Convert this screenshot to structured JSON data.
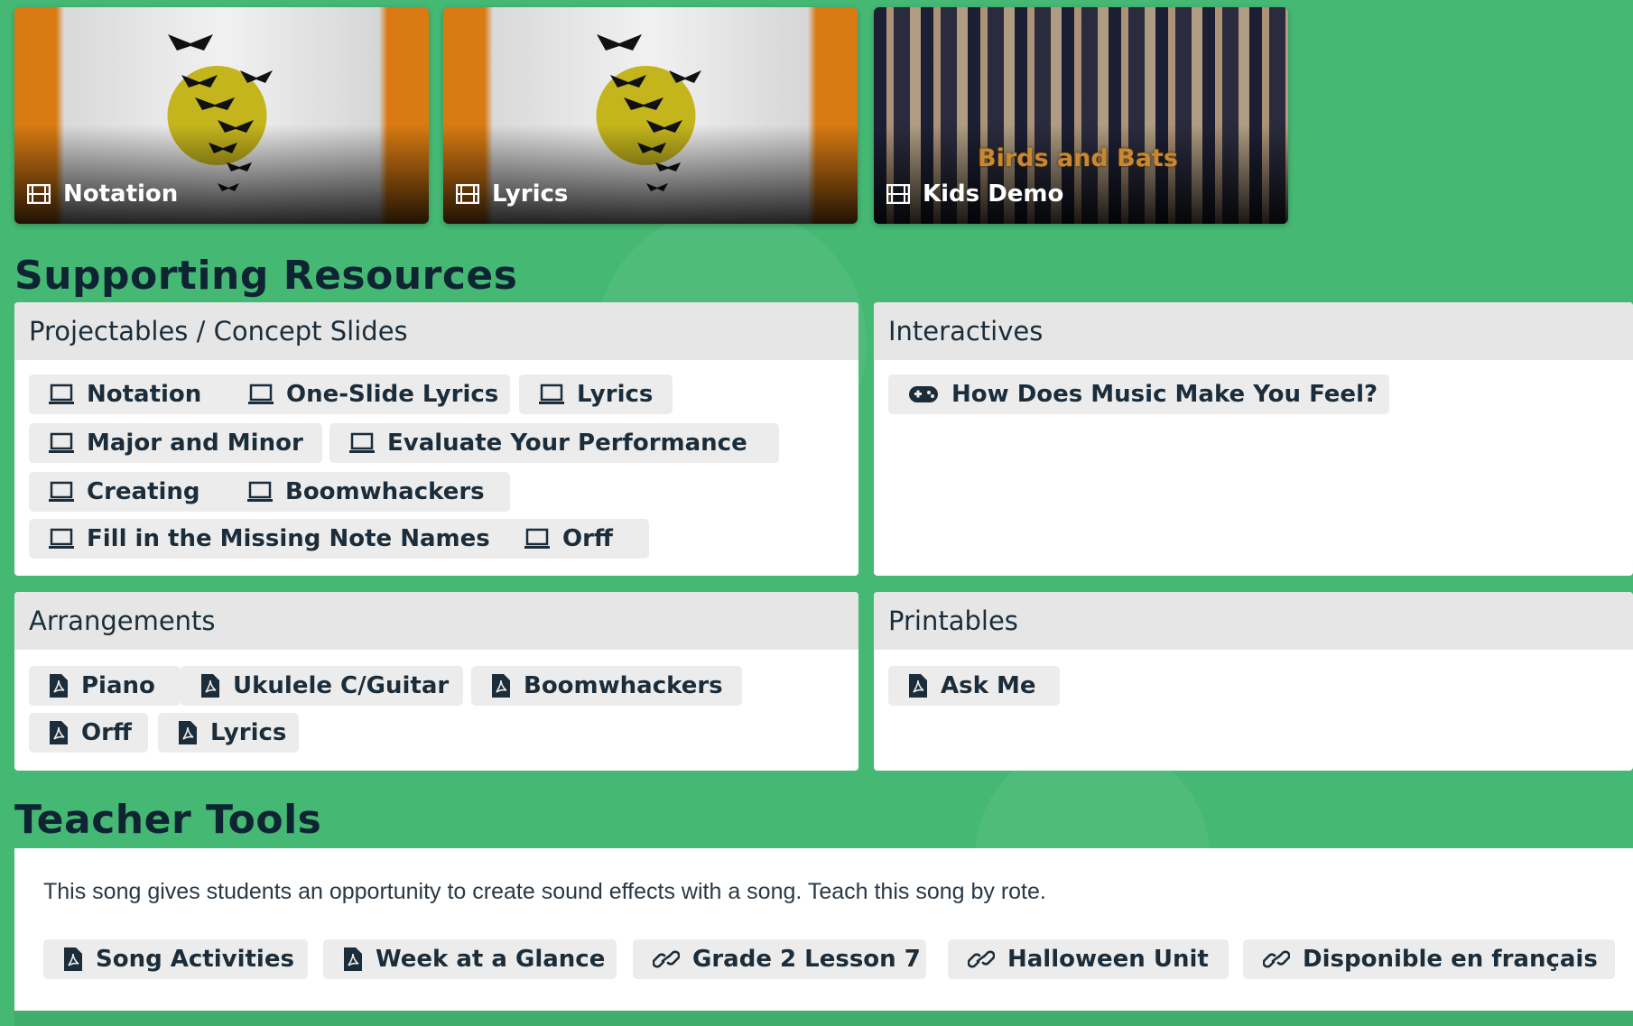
{
  "videos": [
    {
      "label": "Notation",
      "icon": "film-icon"
    },
    {
      "label": "Lyrics",
      "icon": "film-icon"
    },
    {
      "label": "Kids Demo",
      "icon": "film-icon",
      "overlay_text": "Birds and Bats"
    }
  ],
  "supporting": {
    "title": "Supporting Resources",
    "projectables": {
      "heading": "Projectables / Concept Slides",
      "items": [
        "Notation",
        "One-Slide Lyrics",
        "Lyrics",
        "Major and Minor",
        "Evaluate Your Performance",
        "Creating",
        "Boomwhackers",
        "Fill in the Missing Note Names",
        "Orff"
      ]
    },
    "interactives": {
      "heading": "Interactives",
      "items": [
        "How Does Music Make You Feel?"
      ]
    },
    "arrangements": {
      "heading": "Arrangements",
      "items": [
        "Piano",
        "Ukulele C/Guitar",
        "Boomwhackers",
        "Orff",
        "Lyrics"
      ]
    },
    "printables": {
      "heading": "Printables",
      "items": [
        "Ask Me"
      ]
    }
  },
  "teacher_tools": {
    "title": "Teacher Tools",
    "description": "This song gives students an opportunity to create sound effects with a song. Teach this song by rote.",
    "links": [
      {
        "label": "Song Activities",
        "icon": "pdf-icon"
      },
      {
        "label": "Week at a Glance",
        "icon": "pdf-icon"
      },
      {
        "label": "Grade 2 Lesson 7",
        "icon": "link-icon"
      },
      {
        "label": "Halloween Unit",
        "icon": "link-icon"
      },
      {
        "label": "Disponible en français",
        "icon": "link-icon"
      }
    ]
  },
  "colors": {
    "background": "#45b874",
    "heading": "#0f2433",
    "chip": "#ececec",
    "panel_head": "#e6e6e6"
  }
}
